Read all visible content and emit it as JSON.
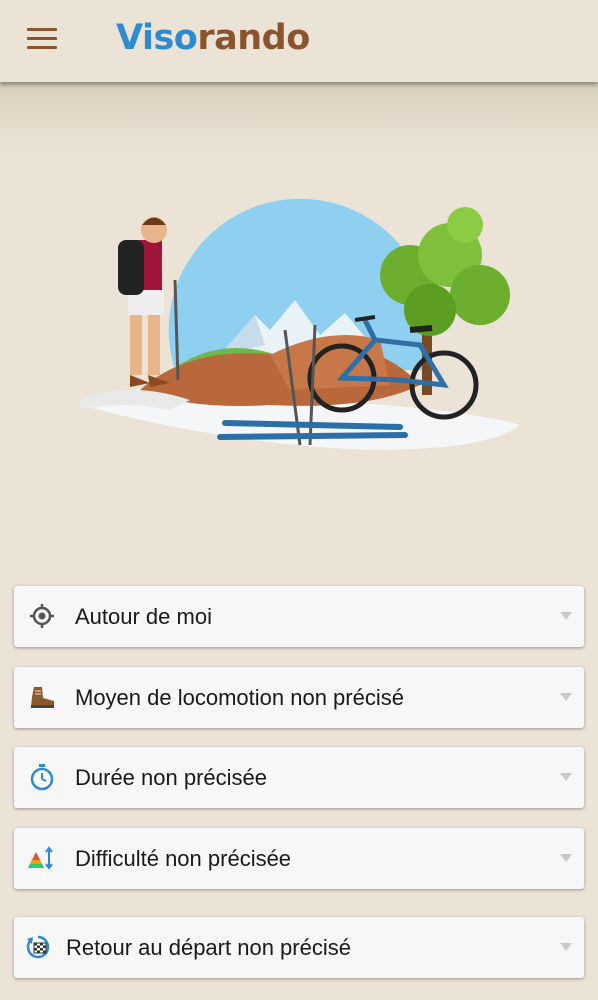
{
  "app": {
    "logo_part1": "Viso",
    "logo_part2": "rando",
    "brand_blue": "#2d8bd1",
    "brand_brown": "#8a552e",
    "menu_icon": "hamburger-menu-icon"
  },
  "filters": [
    {
      "label": "Autour de moi",
      "icon": "location-target-icon"
    },
    {
      "label": "Moyen de locomotion non précisé",
      "icon": "hiking-boot-icon"
    },
    {
      "label": "Durée non précisée",
      "icon": "stopwatch-icon"
    },
    {
      "label": "Difficulté non précisée",
      "icon": "difficulty-mountain-icon"
    },
    {
      "label": "Retour au départ non précisé",
      "icon": "loop-return-flag-icon"
    }
  ]
}
